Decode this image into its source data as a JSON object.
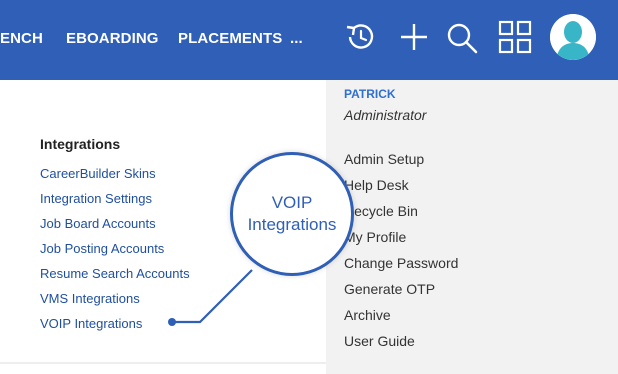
{
  "nav": {
    "items": [
      "ENCH",
      "EBOARDING",
      "PLACEMENTS",
      "..."
    ]
  },
  "icons": {
    "history": "history-icon",
    "add": "plus-icon",
    "search": "search-icon",
    "apps": "grid-icon",
    "avatar": "avatar-icon"
  },
  "settings": {
    "heading": "Integrations",
    "links": [
      "CareerBuilder Skins",
      "Integration Settings",
      "Job Board Accounts",
      "Job Posting Accounts",
      "Resume Search Accounts",
      "VMS Integrations",
      "VOIP Integrations"
    ]
  },
  "account": {
    "name": "PATRICK",
    "role": "Administrator",
    "items": [
      "Admin Setup",
      "Help Desk",
      "Recycle Bin",
      "My Profile",
      "Change Password",
      "Generate OTP",
      "Archive",
      "User Guide"
    ]
  },
  "callout": {
    "line1": "VOIP",
    "line2": "Integrations"
  },
  "colors": {
    "topbar": "#2f5fb6",
    "link": "#1f4f9e",
    "accent": "#2f6fd0",
    "panel": "#f2f2f2"
  }
}
